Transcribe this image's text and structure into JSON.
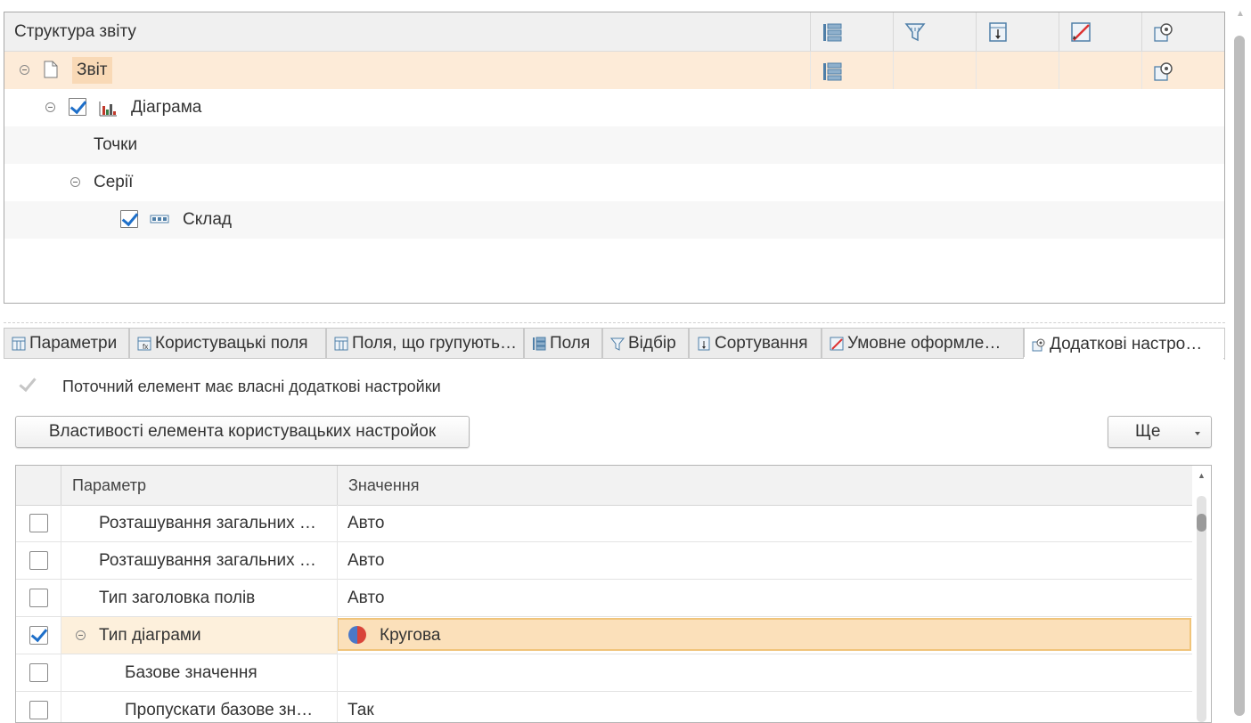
{
  "structure": {
    "title": "Структура звіту",
    "column_icons": [
      "groupings-icon",
      "filter-icon",
      "sorting-icon",
      "conditional-format-icon",
      "settings-icon"
    ],
    "nodes": [
      {
        "label": "Звіт",
        "icon": "document-icon",
        "selected": true
      },
      {
        "label": "Діаграма",
        "icon": "chart-icon",
        "checked": true
      },
      {
        "label": "Точки"
      },
      {
        "label": "Серії"
      },
      {
        "label": "Склад",
        "icon": "grouping-field-icon",
        "checked": true
      }
    ]
  },
  "tabs": [
    {
      "label": "Параметри",
      "icon": "parameters-icon"
    },
    {
      "label": "Користувацькі поля",
      "icon": "custom-fields-icon"
    },
    {
      "label": "Поля, що групують…",
      "icon": "group-fields-icon"
    },
    {
      "label": "Поля",
      "icon": "fields-icon"
    },
    {
      "label": "Відбір",
      "icon": "filter-icon"
    },
    {
      "label": "Сортування",
      "icon": "sorting-icon"
    },
    {
      "label": "Умовне оформле…",
      "icon": "conditional-format-icon"
    },
    {
      "label": "Додаткові настро…",
      "icon": "settings-icon",
      "active": true
    }
  ],
  "own_settings": {
    "label": "Поточний елемент має власні додаткові настройки",
    "checked": true,
    "disabled": true
  },
  "buttons": {
    "properties": "Властивості елемента користувацьких настройок",
    "more": "Ще"
  },
  "params_table": {
    "headers": {
      "parameter": "Параметр",
      "value": "Значення"
    },
    "rows": [
      {
        "name": "Розташування загальних …",
        "value": "Авто",
        "checked": false
      },
      {
        "name": "Розташування загальних …",
        "value": "Авто",
        "checked": false
      },
      {
        "name": "Тип заголовка полів",
        "value": "Авто",
        "checked": false
      },
      {
        "name": "Тип діаграми",
        "value": "Кругова",
        "checked": true,
        "selected": true,
        "value_icon": "pie-chart-icon"
      },
      {
        "name": "Базове значення",
        "value": "",
        "checked": false
      },
      {
        "name": "Пропускати базове зн…",
        "value": "Так",
        "checked": false
      }
    ]
  },
  "colors": {
    "selection_row": "#fdf0dc",
    "selection_cell": "#fbe0ba",
    "checkbox_check": "#1e6fc9"
  }
}
